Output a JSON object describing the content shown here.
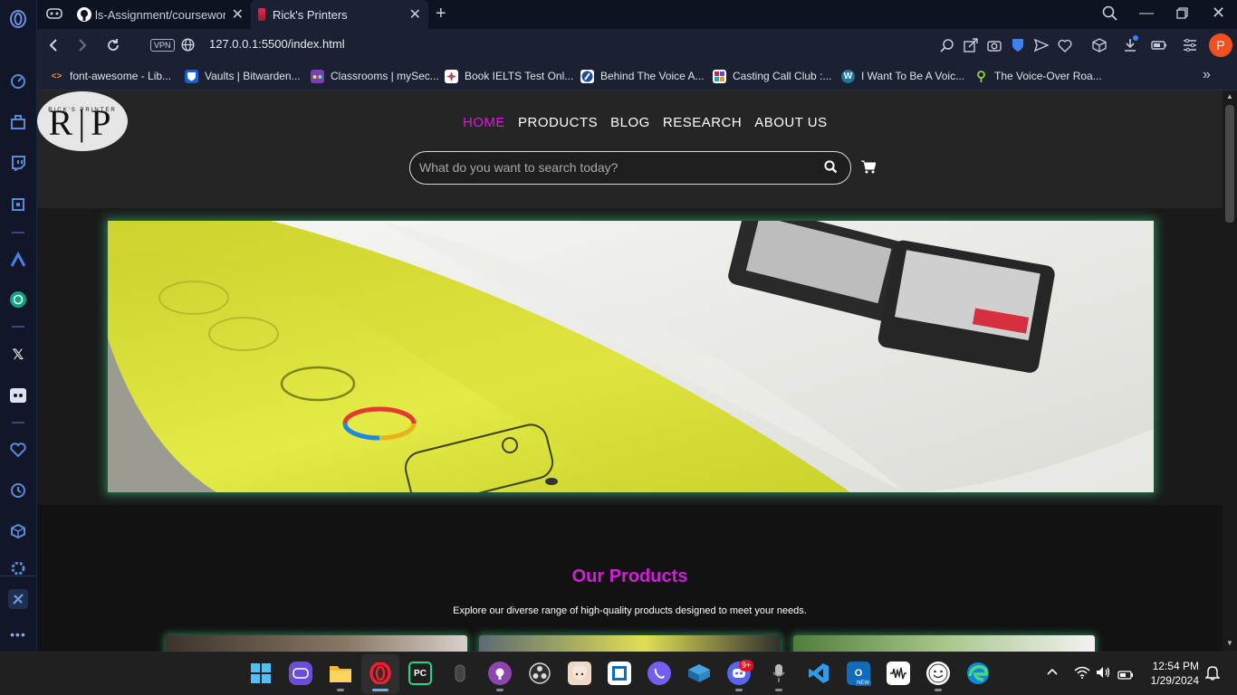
{
  "browser": {
    "tabs": [
      {
        "title": "ls-Assignment/coursework/",
        "active": false
      },
      {
        "title": "Rick's Printers",
        "active": true
      }
    ],
    "url": "127.0.0.1:5500/index.html",
    "vpn_label": "VPN",
    "profile_initial": "P",
    "bookmarks": [
      {
        "label": "font-awesome - Lib...",
        "icon": "code-icon"
      },
      {
        "label": "Vaults | Bitwarden...",
        "icon": "bitwarden-icon"
      },
      {
        "label": "Classrooms | mySec...",
        "icon": "classroom-icon"
      },
      {
        "label": "Book IELTS Test Onl...",
        "icon": "ielts-icon"
      },
      {
        "label": "Behind The Voice A...",
        "icon": "btva-icon"
      },
      {
        "label": "Casting Call Club :...",
        "icon": "casting-icon"
      },
      {
        "label": "I Want To Be A Voic...",
        "icon": "wordpress-icon"
      },
      {
        "label": "The Voice-Over Roa...",
        "icon": "map-pin-icon"
      }
    ]
  },
  "site": {
    "logo_text": "R|P",
    "logo_sub": "RICK'S PRINTER",
    "nav": [
      {
        "label": "HOME",
        "active": true
      },
      {
        "label": "PRODUCTS",
        "active": false
      },
      {
        "label": "BLOG",
        "active": false
      },
      {
        "label": "RESEARCH",
        "active": false
      },
      {
        "label": "ABOUT US",
        "active": false
      }
    ],
    "search_placeholder": "What do you want to search today?",
    "products_title": "Our Products",
    "products_desc": "Explore our diverse range of high-quality products designed to meet your needs.",
    "accent_color": "#d11fd6"
  },
  "taskbar": {
    "time": "12:54 PM",
    "date": "1/29/2024",
    "discord_badge": "9+",
    "apps": [
      "start",
      "twitch-app",
      "file-explorer",
      "opera",
      "pycharm",
      "mouse-app",
      "github-desktop",
      "obs",
      "anime-app",
      "notepad",
      "viber",
      "virtualbox",
      "discord",
      "microphone-app",
      "vscode",
      "outlook",
      "audio-app",
      "emoji-app",
      "edge"
    ]
  }
}
